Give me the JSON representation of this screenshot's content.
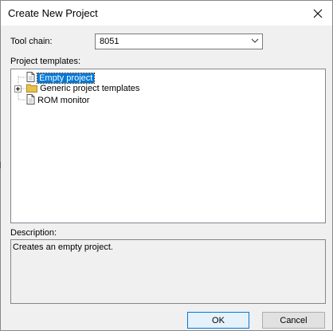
{
  "window": {
    "title": "Create New Project",
    "close_icon": "close-icon"
  },
  "toolchain": {
    "label": "Tool chain:",
    "value": "8051"
  },
  "templates": {
    "label": "Project templates:",
    "items": [
      {
        "label": "Empty project",
        "icon": "document-icon",
        "selected": true
      },
      {
        "label": "Generic project templates",
        "icon": "folder-icon",
        "expander": "+"
      },
      {
        "label": "ROM monitor",
        "icon": "document-icon"
      }
    ]
  },
  "description": {
    "label": "Description:",
    "text": "Creates an empty project."
  },
  "buttons": {
    "ok": "OK",
    "cancel": "Cancel"
  },
  "colors": {
    "selection": "#0078d7",
    "folder": "#e8c04f"
  }
}
